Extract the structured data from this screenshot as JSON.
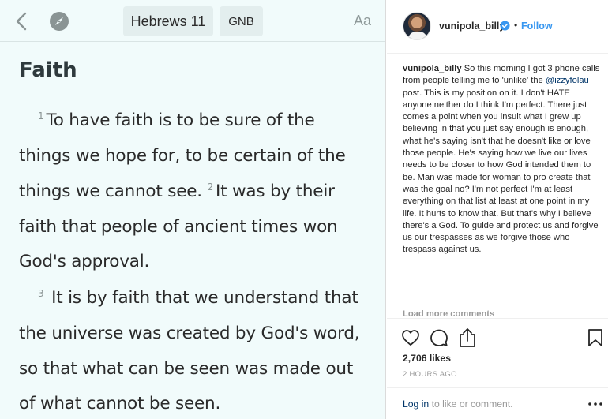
{
  "bible": {
    "book_chapter": "Hebrews 11",
    "version": "GNB",
    "font_button": "Aa",
    "heading": "Faith",
    "verse1_num": "1",
    "line1": "To have faith is to be sure of the",
    "line2": "things we hope for, to be certain of the",
    "line3_a": "things we cannot see.",
    "verse2_num": "2",
    "line3_b": "It was by their",
    "line4": "faith that people of ancient times won",
    "line5": "God's approval.",
    "verse3_num": "3",
    "line6": "It is by faith that we understand that",
    "line7": "the universe was created by God's word,",
    "line8": "so that what can be seen was made out",
    "line9": "of what cannot be seen."
  },
  "instagram": {
    "username": "vunipola_billy",
    "separator": "•",
    "follow_label": "Follow",
    "caption_user": "vunipola_billy",
    "caption_part1": "So this morning I got 3 phone calls from people telling me to 'unlike' the",
    "caption_mention": "@izzyfolau",
    "caption_part2": "post. This is my position on it. I don't HATE anyone neither do I think I'm perfect. There just comes a point when you insult what I grew up believing in that you just say enough is enough, what he's saying isn't that he doesn't like or love those people. He's saying how we live our lives needs to be closer to how God intended them to be. Man was made for woman to pro create that was the goal no? I'm not perfect I'm at least everything on that list at least at one point in my life. It hurts to know that. But that's why I believe there's a God. To guide and protect us and forgive us our trespasses as we forgive those who trespass against us.",
    "load_more": "Load more comments",
    "likes": "2,706 likes",
    "timestamp": "2 HOURS AGO",
    "login_link": "Log in",
    "login_rest": "to like or comment.",
    "colors": {
      "accent": "#3897f0",
      "link": "#003569",
      "muted": "#999999",
      "text": "#262626"
    },
    "icons": [
      "verified-icon",
      "heart-icon",
      "comment-icon",
      "share-icon",
      "bookmark-icon",
      "more-icon"
    ]
  }
}
